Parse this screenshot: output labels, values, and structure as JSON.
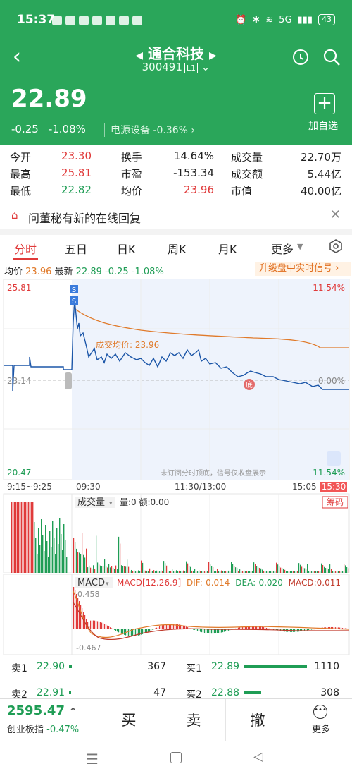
{
  "status_bar": {
    "time": "15:37",
    "battery": "43",
    "network": "5G"
  },
  "header": {
    "back_icon": "back-arrow-icon",
    "title": "通合科技",
    "code": "300491",
    "level": "L1",
    "price": "22.89",
    "change": "-0.25",
    "change_pct": "-1.08%",
    "sector_name": "电源设备",
    "sector_pct": "-0.36%",
    "add_label": "加自选"
  },
  "stats": [
    {
      "k": "今开",
      "v": "23.30",
      "c": "red"
    },
    {
      "k": "换手",
      "v": "14.64%",
      "c": ""
    },
    {
      "k": "成交量",
      "v": "22.70万",
      "c": ""
    },
    {
      "k": "最高",
      "v": "25.81",
      "c": "red"
    },
    {
      "k": "市盈",
      "v": "-153.34",
      "c": ""
    },
    {
      "k": "成交额",
      "v": "5.44亿",
      "c": ""
    },
    {
      "k": "最低",
      "v": "22.82",
      "c": "grn"
    },
    {
      "k": "均价",
      "v": "23.96",
      "c": "red"
    },
    {
      "k": "市值",
      "v": "40.00亿",
      "c": ""
    }
  ],
  "notice": {
    "text": "问董秘有新的在线回复"
  },
  "tabs": [
    "分时",
    "五日",
    "日K",
    "周K",
    "月K",
    "更多"
  ],
  "quote_line": {
    "avg_label": "均价",
    "avg": "23.96",
    "last_label": "最新",
    "last": "22.89",
    "chg": "-0.25",
    "pct": "-1.08%",
    "upgrade": "升级盘中实时信号"
  },
  "chart_labels": {
    "high": "25.81",
    "high_pct": "11.54%",
    "low": "20.47",
    "low_pct": "-11.54%",
    "base": "23.14",
    "base_pct": "0.00%",
    "avg_note": "成交均价: 23.96",
    "disclaimer": "未订阅分时顶底，信号仅收盘展示",
    "bottom_mark": "底",
    "s_mark": "S",
    "times": [
      "9:15~9:25",
      "09:30",
      "11:30/13:00",
      "15:05",
      "15:30"
    ]
  },
  "volume": {
    "label": "成交量",
    "qty": "量:0 额:0.00",
    "chip_btn": "筹码"
  },
  "macd": {
    "label": "MACD",
    "params": "MACD[12.26.9]",
    "dif": "DIF:-0.014",
    "dea": "DEA:-0.020",
    "macd": "MACD:0.011",
    "top": "0.458",
    "bottom": "-0.467"
  },
  "book": {
    "sells": [
      {
        "label": "卖1",
        "price": "22.90",
        "vol": "367",
        "frac": 0.12
      },
      {
        "label": "卖2",
        "price": "22.91",
        "vol": "47",
        "frac": 0.02
      }
    ],
    "buys": [
      {
        "label": "买1",
        "price": "22.89",
        "vol": "1110",
        "frac": 0.9
      },
      {
        "label": "买2",
        "price": "22.88",
        "vol": "308",
        "frac": 0.25
      }
    ]
  },
  "bottom": {
    "index_value": "2595.47",
    "index_name": "创业板指",
    "index_pct": "-0.47%",
    "buy": "买",
    "sell": "卖",
    "cancel": "撤",
    "more": "更多"
  },
  "colors": {
    "green": "#2aa65a",
    "red": "#e03a3a",
    "line": "#1c56a8",
    "avg": "#e07a2a"
  }
}
